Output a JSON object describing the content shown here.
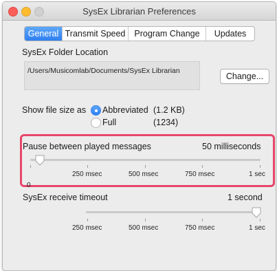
{
  "window": {
    "title": "SysEx Librarian Preferences"
  },
  "tabs": [
    {
      "label": "General",
      "active": true
    },
    {
      "label": "Transmit Speed",
      "active": false
    },
    {
      "label": "Program Change",
      "active": false
    },
    {
      "label": "Updates",
      "active": false
    }
  ],
  "folder": {
    "label": "SysEx Folder Location",
    "path": "/Users/Musicomlab/Documents/SysEx Librarian",
    "change_button": "Change..."
  },
  "file_size": {
    "label": "Show file size as",
    "options": [
      {
        "label": "Abbreviated",
        "example": "(1.2 KB)",
        "selected": true
      },
      {
        "label": "Full",
        "example": "(1234)",
        "selected": false
      }
    ]
  },
  "pause": {
    "label": "Pause between played messages",
    "value_text": "50 milliseconds",
    "slider_value_msec": 50,
    "tick_labels": [
      "250 msec",
      "500 msec",
      "750 msec",
      "1 sec"
    ],
    "min_label": "0"
  },
  "timeout": {
    "label": "SysEx receive timeout",
    "value_text": "1 second",
    "slider_value_sec": 1,
    "tick_labels": [
      "250 msec",
      "500 msec",
      "750 msec",
      "1 sec"
    ]
  },
  "colors": {
    "accent": "#2f7ff0",
    "highlight": "#e8456a"
  }
}
